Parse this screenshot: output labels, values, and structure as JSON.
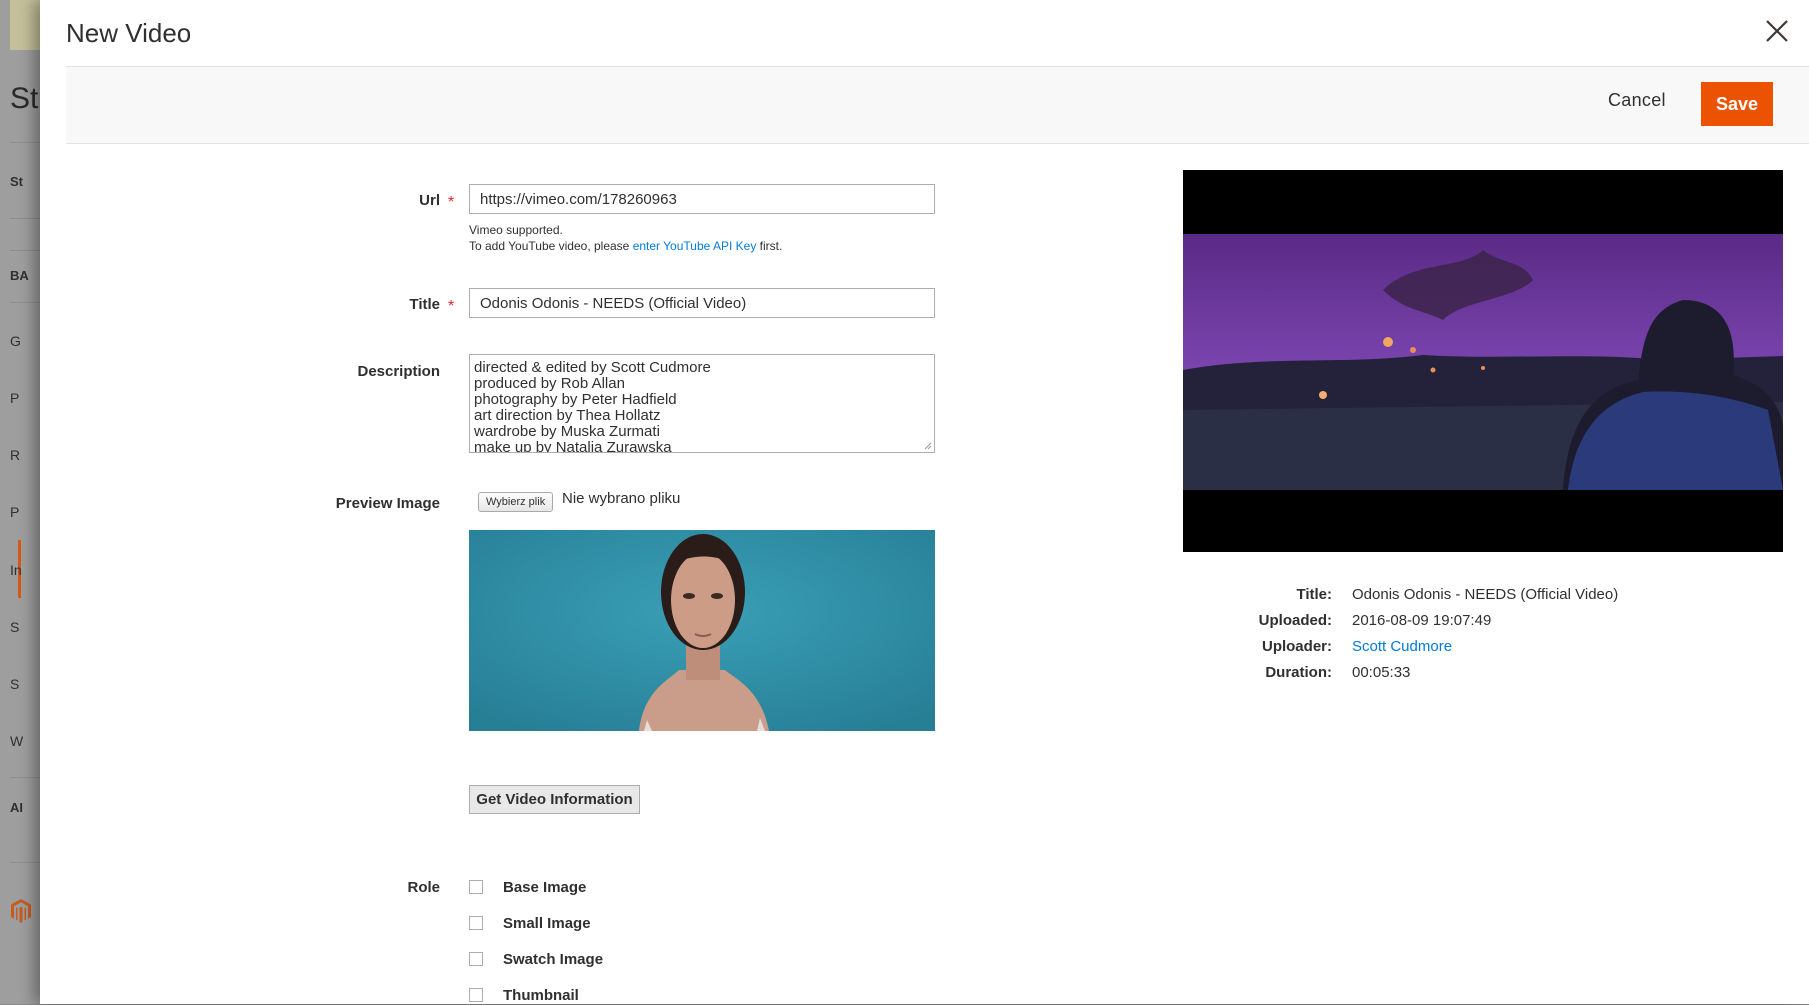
{
  "background": {
    "heading_fragment": "St",
    "nav_fragments": [
      "St",
      "BA",
      "G",
      "P",
      "R",
      "P",
      "In",
      "S",
      "S",
      "W",
      "AI"
    ]
  },
  "modal": {
    "title": "New Video",
    "close_icon": "close-icon",
    "actions": {
      "cancel_label": "Cancel",
      "save_label": "Save"
    },
    "accent_color": "#eb5202",
    "link_color": "#007bdb"
  },
  "form": {
    "url": {
      "label": "Url",
      "required_mark": "*",
      "value": "https://vimeo.com/178260963",
      "note_line1": "Vimeo supported.",
      "note_line2_prefix": "To add YouTube video, please ",
      "note_line2_link": "enter YouTube API Key",
      "note_line2_suffix": " first."
    },
    "title": {
      "label": "Title",
      "required_mark": "*",
      "value": "Odonis Odonis - NEEDS (Official Video)"
    },
    "description": {
      "label": "Description",
      "lines": [
        "directed & edited by Scott Cudmore",
        "produced by Rob Allan",
        "photography by Peter Hadfield",
        "art direction by Thea Hollatz",
        "wardrobe by Muska Zurmati",
        "make up by Natalia Zurawska"
      ]
    },
    "preview_image": {
      "label": "Preview Image",
      "choose_button": "Wybierz plik",
      "file_status": "Nie wybrano pliku"
    },
    "get_info_button": "Get Video Information",
    "role": {
      "label": "Role",
      "options": [
        {
          "label": "Base Image",
          "checked": false
        },
        {
          "label": "Small Image",
          "checked": false
        },
        {
          "label": "Swatch Image",
          "checked": false
        },
        {
          "label": "Thumbnail",
          "checked": false
        }
      ]
    }
  },
  "video_info": {
    "title_key": "Title:",
    "title_value": "Odonis Odonis - NEEDS (Official Video)",
    "uploaded_key": "Uploaded:",
    "uploaded_value": "2016-08-09 19:07:49",
    "uploader_key": "Uploader:",
    "uploader_value": "Scott Cudmore",
    "duration_key": "Duration:",
    "duration_value": "00:05:33"
  }
}
